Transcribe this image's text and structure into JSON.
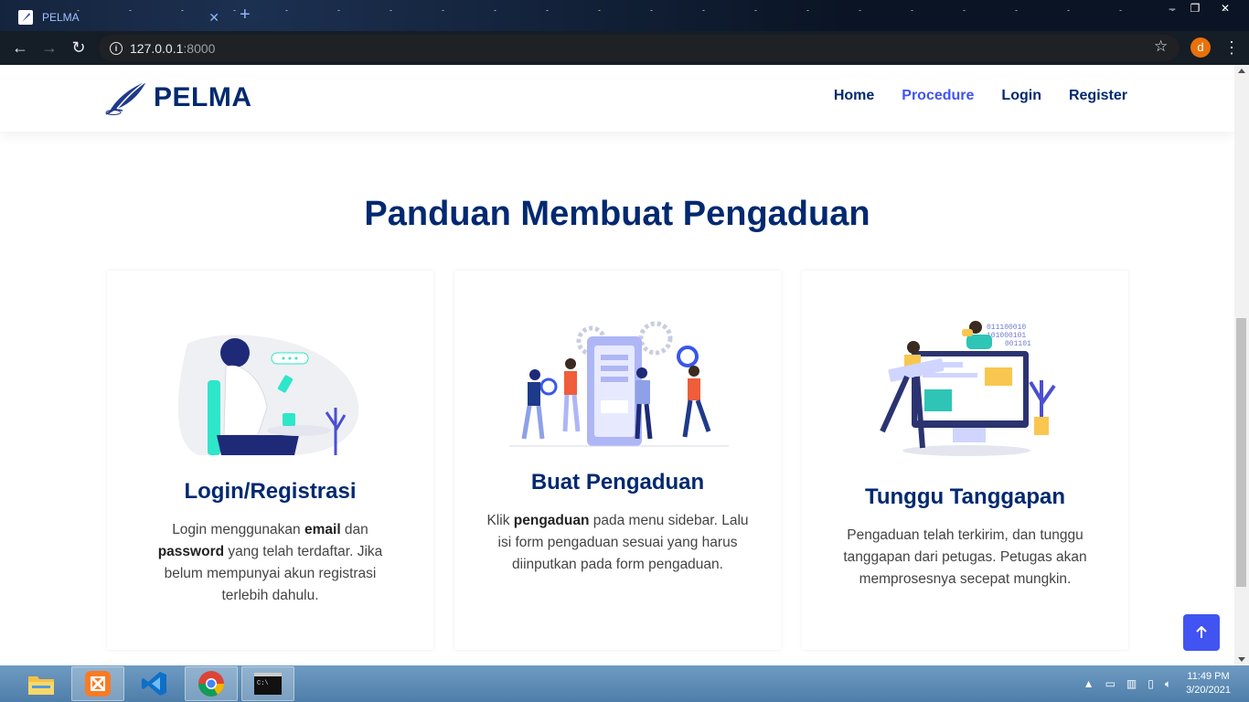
{
  "browser": {
    "tab_title": "PELMA",
    "url_host": "127.0.0.1",
    "url_port": ":8000",
    "profile_initial": "d"
  },
  "site": {
    "brand": "PELMA",
    "nav": [
      {
        "label": "Home",
        "active": false
      },
      {
        "label": "Procedure",
        "active": true
      },
      {
        "label": "Login",
        "active": false
      },
      {
        "label": "Register",
        "active": false
      }
    ]
  },
  "section": {
    "title": "Panduan Membuat Pengaduan",
    "cards": [
      {
        "title": "Login/Registrasi",
        "text_parts": [
          "Login menggunakan ",
          "email",
          " dan ",
          "password",
          " yang telah terdaftar. Jika belum mempunyai akun registrasi terlebih dahulu."
        ]
      },
      {
        "title": "Buat Pengaduan",
        "text_parts": [
          "Klik ",
          "pengaduan",
          " pada menu sidebar. Lalu isi form pengaduan sesuai yang harus diinputkan pada form pengaduan."
        ]
      },
      {
        "title": "Tunggu Tanggapan",
        "text": "Pengaduan telah terkirim, dan tunggu tanggapan dari petugas. Petugas akan memprosesnya secepat mungkin.",
        "illustration_code": [
          "011100010",
          "101000101",
          "001101"
        ]
      }
    ]
  },
  "taskbar": {
    "time": "11:49 PM",
    "date": "3/20/2021",
    "apps": [
      "file-explorer",
      "xampp",
      "vscode",
      "chrome",
      "cmd"
    ]
  },
  "colors": {
    "brand_navy": "#012970",
    "accent_blue": "#4154f1",
    "text_gray": "#444444"
  }
}
